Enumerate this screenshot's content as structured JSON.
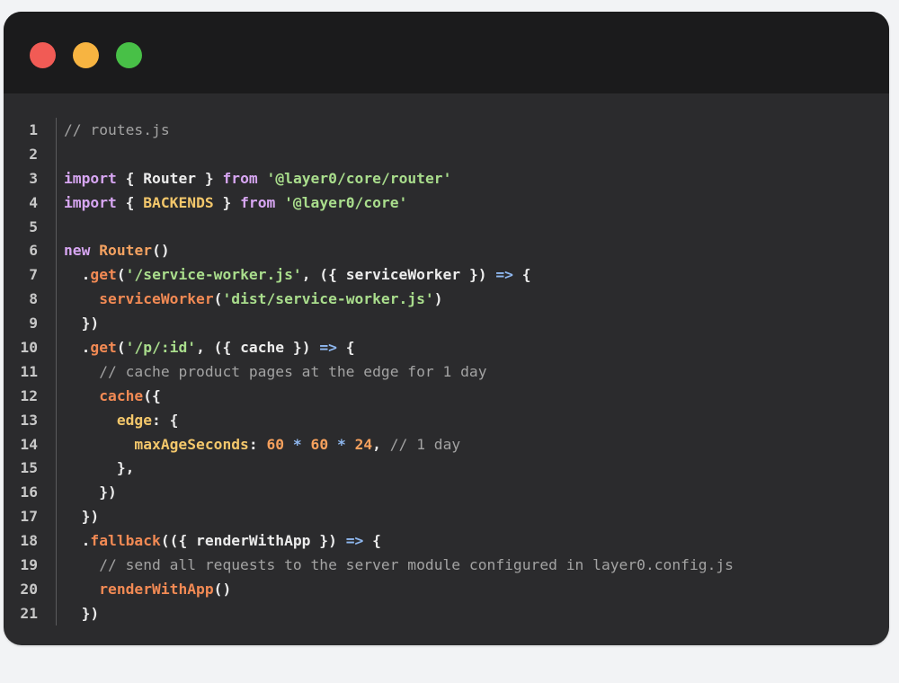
{
  "window": {
    "controls": [
      {
        "name": "close-button",
        "color": "#f15b55"
      },
      {
        "name": "minimize-button",
        "color": "#f7b441"
      },
      {
        "name": "maximize-button",
        "color": "#48c047"
      }
    ]
  },
  "colors": {
    "background": "#f2f3f5",
    "window": "#2b2b2d",
    "titlebar": "#1b1b1c"
  },
  "code_lines": [
    {
      "n": "1",
      "tokens": [
        [
          "comment",
          "// routes.js"
        ]
      ]
    },
    {
      "n": "2",
      "tokens": []
    },
    {
      "n": "3",
      "tokens": [
        [
          "keyword",
          "import"
        ],
        [
          "plain",
          " { "
        ],
        [
          "plain",
          "Router"
        ],
        [
          "plain",
          " } "
        ],
        [
          "keyword",
          "from"
        ],
        [
          "plain",
          " "
        ],
        [
          "string",
          "'@layer0/core/router'"
        ]
      ]
    },
    {
      "n": "4",
      "tokens": [
        [
          "keyword",
          "import"
        ],
        [
          "plain",
          " { "
        ],
        [
          "builtin",
          "BACKENDS"
        ],
        [
          "plain",
          " } "
        ],
        [
          "keyword",
          "from"
        ],
        [
          "plain",
          " "
        ],
        [
          "string",
          "'@layer0/core'"
        ]
      ]
    },
    {
      "n": "5",
      "tokens": []
    },
    {
      "n": "6",
      "tokens": [
        [
          "keyword",
          "new"
        ],
        [
          "plain",
          " "
        ],
        [
          "func",
          "Router"
        ],
        [
          "plain",
          "()"
        ]
      ]
    },
    {
      "n": "7",
      "tokens": [
        [
          "plain",
          "  ."
        ],
        [
          "call",
          "get"
        ],
        [
          "plain",
          "("
        ],
        [
          "string",
          "'/service-worker.js'"
        ],
        [
          "plain",
          ", ({ serviceWorker }) "
        ],
        [
          "operator",
          "=>"
        ],
        [
          "plain",
          " {"
        ]
      ]
    },
    {
      "n": "8",
      "tokens": [
        [
          "plain",
          "    "
        ],
        [
          "call",
          "serviceWorker"
        ],
        [
          "plain",
          "("
        ],
        [
          "string",
          "'dist/service-worker.js'"
        ],
        [
          "plain",
          ")"
        ]
      ]
    },
    {
      "n": "9",
      "tokens": [
        [
          "plain",
          "  })"
        ]
      ]
    },
    {
      "n": "10",
      "tokens": [
        [
          "plain",
          "  ."
        ],
        [
          "call",
          "get"
        ],
        [
          "plain",
          "("
        ],
        [
          "string",
          "'/p/:id'"
        ],
        [
          "plain",
          ", ({ cache }) "
        ],
        [
          "operator",
          "=>"
        ],
        [
          "plain",
          " {"
        ]
      ]
    },
    {
      "n": "11",
      "tokens": [
        [
          "plain",
          "    "
        ],
        [
          "comment",
          "// cache product pages at the edge for 1 day"
        ]
      ]
    },
    {
      "n": "12",
      "tokens": [
        [
          "plain",
          "    "
        ],
        [
          "call",
          "cache"
        ],
        [
          "plain",
          "({"
        ]
      ]
    },
    {
      "n": "13",
      "tokens": [
        [
          "plain",
          "      "
        ],
        [
          "prop",
          "edge"
        ],
        [
          "plain",
          ": {"
        ]
      ]
    },
    {
      "n": "14",
      "tokens": [
        [
          "plain",
          "        "
        ],
        [
          "prop",
          "maxAgeSeconds"
        ],
        [
          "plain",
          ": "
        ],
        [
          "number",
          "60"
        ],
        [
          "plain",
          " "
        ],
        [
          "operator",
          "*"
        ],
        [
          "plain",
          " "
        ],
        [
          "number",
          "60"
        ],
        [
          "plain",
          " "
        ],
        [
          "operator",
          "*"
        ],
        [
          "plain",
          " "
        ],
        [
          "number",
          "24"
        ],
        [
          "plain",
          ", "
        ],
        [
          "comment",
          "// 1 day"
        ]
      ]
    },
    {
      "n": "15",
      "tokens": [
        [
          "plain",
          "      },"
        ]
      ]
    },
    {
      "n": "16",
      "tokens": [
        [
          "plain",
          "    })"
        ]
      ]
    },
    {
      "n": "17",
      "tokens": [
        [
          "plain",
          "  })"
        ]
      ]
    },
    {
      "n": "18",
      "tokens": [
        [
          "plain",
          "  ."
        ],
        [
          "call",
          "fallback"
        ],
        [
          "plain",
          "(({ renderWithApp }) "
        ],
        [
          "operator",
          "=>"
        ],
        [
          "plain",
          " {"
        ]
      ]
    },
    {
      "n": "19",
      "tokens": [
        [
          "plain",
          "    "
        ],
        [
          "comment",
          "// send all requests to the server module configured in layer0.config.js"
        ]
      ]
    },
    {
      "n": "20",
      "tokens": [
        [
          "plain",
          "    "
        ],
        [
          "call",
          "renderWithApp"
        ],
        [
          "plain",
          "()"
        ]
      ]
    },
    {
      "n": "21",
      "tokens": [
        [
          "plain",
          "  })"
        ]
      ]
    }
  ]
}
